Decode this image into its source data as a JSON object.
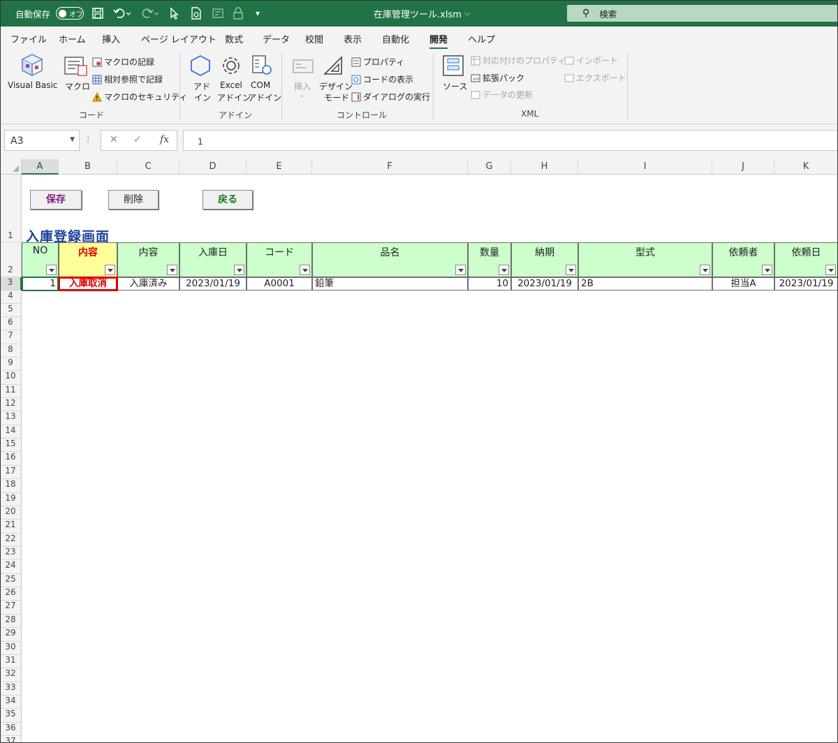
{
  "titlebar": {
    "autosave_label": "自動保存",
    "autosave_state": "オフ",
    "filename": "在庫管理ツール.xlsm",
    "search_placeholder": "検索"
  },
  "ribbon_tabs": [
    "ファイル",
    "ホーム",
    "挿入",
    "ページ レイアウト",
    "数式",
    "データ",
    "校閲",
    "表示",
    "自動化",
    "開発",
    "ヘルプ"
  ],
  "active_tab": "開発",
  "ribbon": {
    "code": {
      "label": "コード",
      "visual_basic": "Visual Basic",
      "macro": "マクロ",
      "record_macro": "マクロの記録",
      "relative_ref": "相対参照で記録",
      "macro_security": "マクロのセキュリティ"
    },
    "addins": {
      "label": "アドイン",
      "addin_1": "アド",
      "addin_2": "イン",
      "excel_addin_1": "Excel",
      "excel_addin_2": "アドイン",
      "com_addin_1": "COM",
      "com_addin_2": "アドイン"
    },
    "controls": {
      "label": "コントロール",
      "insert": "挿入",
      "design_1": "デザイン",
      "design_2": "モード",
      "properties": "プロパティ",
      "view_code": "コードの表示",
      "run_dialog": "ダイアログの実行"
    },
    "xml": {
      "label": "XML",
      "source": "ソース",
      "map_properties": "対応付けのプロパティ",
      "expansion_packs": "拡張パック",
      "refresh_data": "データの更新",
      "import": "インポート",
      "export": "エクスポート"
    }
  },
  "formula_bar": {
    "name_box": "A3",
    "fx": "fx",
    "formula": "1"
  },
  "columns": [
    "A",
    "B",
    "C",
    "D",
    "E",
    "F",
    "G",
    "H",
    "I",
    "J",
    "K"
  ],
  "rows": [
    "1",
    "2",
    "3",
    "4",
    "5",
    "6",
    "7",
    "8",
    "9",
    "10",
    "11",
    "12",
    "13",
    "14",
    "15",
    "16",
    "17",
    "18",
    "19",
    "20",
    "21",
    "22",
    "23",
    "24",
    "25",
    "26",
    "27",
    "28",
    "29",
    "30",
    "31",
    "32",
    "33",
    "34",
    "35",
    "36",
    "37"
  ],
  "sheet": {
    "buttons": {
      "save": "保存",
      "delete": "削除",
      "back": "戻る"
    },
    "title": "入庫登録画面",
    "headers": [
      "NO",
      "内容",
      "内容",
      "入庫日",
      "コード",
      "品名",
      "数量",
      "納期",
      "型式",
      "依頼者",
      "依頼日"
    ],
    "row3": [
      "1",
      "入庫取消",
      "入庫済み",
      "2023/01/19",
      "A0001",
      "鉛筆",
      "10",
      "2023/01/19",
      "2B",
      "担当A",
      "2023/01/19"
    ]
  },
  "colors": {
    "excel_green": "#217346",
    "header_green": "#ccffcc",
    "header_yellow": "#ffff99",
    "alert_red": "#e00000",
    "title_blue": "#1f3f9a"
  }
}
